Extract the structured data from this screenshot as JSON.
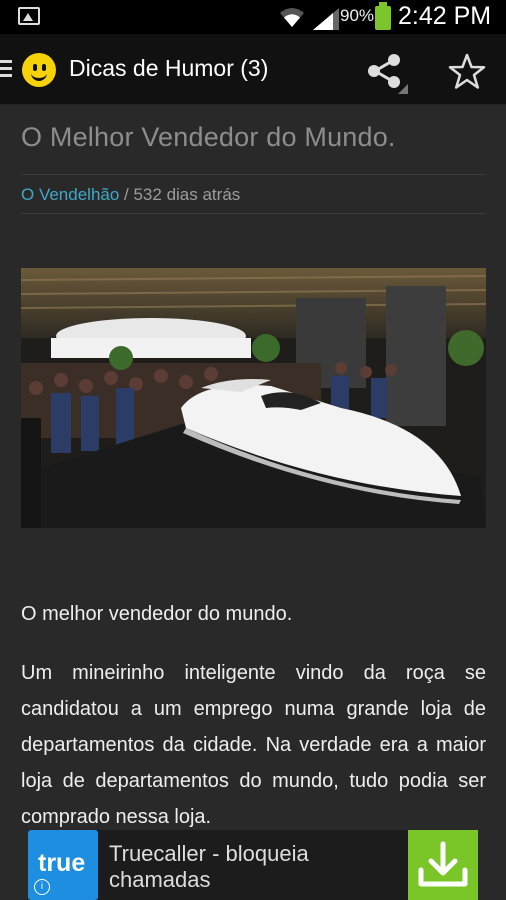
{
  "status_bar": {
    "battery_percent": "90%",
    "time": "2:42 PM",
    "icons": [
      "image-notification-icon",
      "wifi-icon",
      "signal-icon",
      "battery-icon"
    ]
  },
  "app_bar": {
    "title": "Dicas de Humor (3)",
    "icons": [
      "menu-icon",
      "smiley-icon",
      "share-icon",
      "star-icon"
    ]
  },
  "article": {
    "title": "O Melhor Vendedor do Mundo.",
    "author": "O Vendelhão",
    "meta_suffix": " / 532 dias atrás",
    "paragraphs": [
      "O melhor vendedor do mundo.",
      "Um mineirinho inteligente vindo da roça se candidatou a um emprego numa grande loja de departamentos da cidade. Na verdade era a maior loja de departamentos do mundo, tudo podia ser comprado nessa loja."
    ]
  },
  "ad": {
    "logo_text": "true",
    "info_glyph": "i",
    "title": "Truecaller - bloqueia chamadas",
    "colors": {
      "logo": "#1d8ee0",
      "download": "#7ac628"
    }
  },
  "colors": {
    "accent_link": "#3fa7c8",
    "background": "#292929"
  }
}
